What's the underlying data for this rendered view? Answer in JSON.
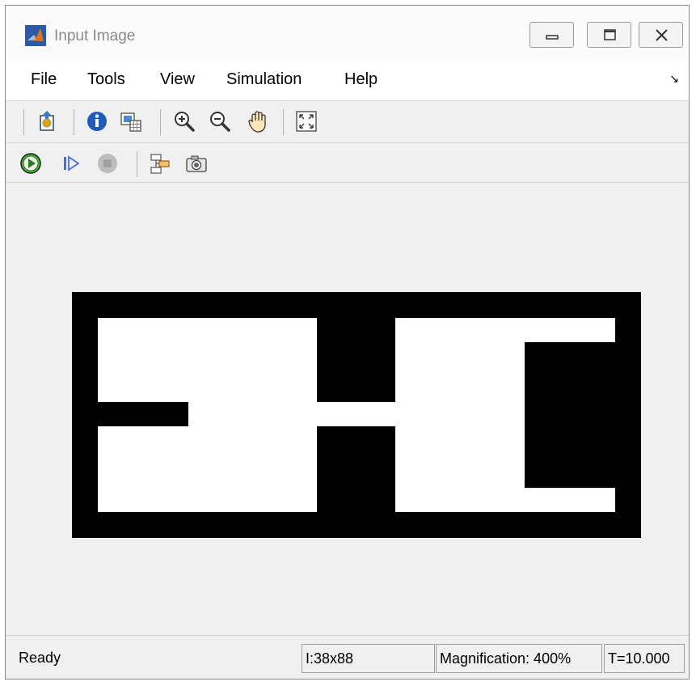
{
  "window": {
    "title": "Input Image",
    "app_icon": "matlab-icon",
    "controls": [
      "minimize-icon",
      "maximize-icon",
      "close-icon"
    ]
  },
  "menu": {
    "items": [
      "File",
      "Tools",
      "View",
      "Simulation",
      "Help"
    ],
    "dock_arrow": "↘"
  },
  "toolbar1": {
    "icons": [
      "print-to-figure-icon",
      "info-icon",
      "pixel-region-icon",
      "zoom-in-icon",
      "zoom-out-icon",
      "pan-icon",
      "fit-to-view-icon"
    ]
  },
  "toolbar2": {
    "icons": [
      "run-icon",
      "step-forward-icon",
      "stop-icon",
      "highlight-model-icon",
      "snapshot-icon"
    ]
  },
  "image": {
    "colors": {
      "background": "#000000",
      "foreground": "#ffffff"
    }
  },
  "status": {
    "state": "Ready",
    "dimensions": "I:38x88",
    "magnification": "Magnification: 400%",
    "time": "T=10.000"
  }
}
